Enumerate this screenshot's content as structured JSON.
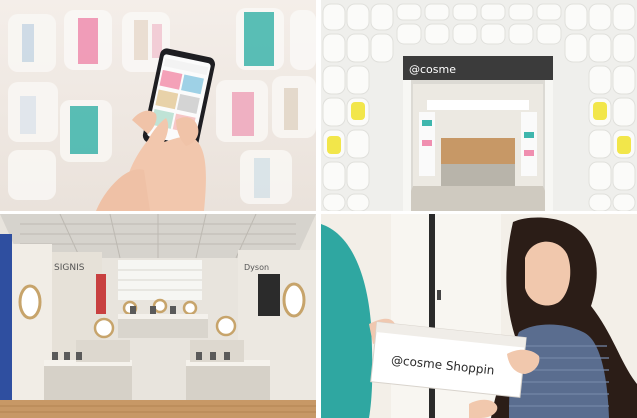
{
  "panels": {
    "top_left": {
      "subject": "hand-holding-smartphone-in-store"
    },
    "top_right": {
      "subject": "cosme-store-entrance",
      "store_sign": "@cosme"
    },
    "bottom_left": {
      "subject": "cosmetics-store-interior",
      "brand_signs": [
        "SIGNIS",
        "Dyson"
      ]
    },
    "bottom_right": {
      "subject": "woman-receiving-shopping-box",
      "box_text": "@cosme Shoppin"
    }
  },
  "colors": {
    "wall_light": "#f1ebe6",
    "phone_dark": "#1e1e22",
    "wall_white": "#f7f7f4",
    "teal": "#3fb6ad",
    "pink": "#f08fb0",
    "wood": "#c79866",
    "shirt_teal": "#2fa7a1"
  }
}
